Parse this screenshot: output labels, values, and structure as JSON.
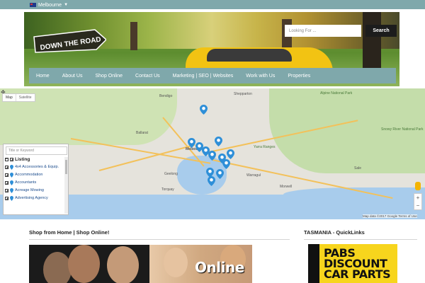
{
  "topbar": {
    "location": "Melbourne",
    "accent": "#7fa8ab"
  },
  "header": {
    "logo_text": "DOWN THE ROAD",
    "search_placeholder": "Looking For ...",
    "search_button": "Search"
  },
  "nav": {
    "items": [
      "Home",
      "About Us",
      "Shop Online",
      "Contact Us",
      "Marketing | SEO | Websites",
      "Work with Us",
      "Properties"
    ]
  },
  "map": {
    "tabs": [
      "Map",
      "Satellite"
    ],
    "footer": "Map data ©2017 Google   Terms of Use",
    "zoom_in": "+",
    "zoom_out": "−",
    "labels": [
      "Alpine National Park",
      "Snowy River National Park",
      "Bendigo",
      "Ballarat",
      "Melbourne",
      "Geelong",
      "Torquay",
      "Warragul",
      "Morwell",
      "Sale",
      "Shepparton",
      "Yarra Ranges"
    ],
    "filter": {
      "placeholder": "Title or Keyword",
      "heading": "Listing",
      "items": [
        "4x4 Accessories & Equip.",
        "Accommodation",
        "Accountants",
        "Acreage Mowing",
        "Advertising Agency"
      ]
    }
  },
  "sections": {
    "shop_title": "Shop from Home | Shop Online!",
    "tasmania_title": "TASMANIA - QuickLinks",
    "banner_text": "Online",
    "pabs_text": "PABS DISCOUNT CAR PARTS"
  }
}
